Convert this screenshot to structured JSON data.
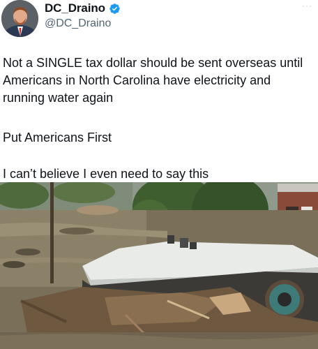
{
  "author": {
    "display_name": "DC_Draino",
    "handle": "@DC_Draino",
    "verified": true,
    "verified_color": "#1d9bf0"
  },
  "menu": {
    "more_icon": "···"
  },
  "tweet": {
    "paragraph_1": "Not a SINGLE tax dollar should be sent overseas until Americans in North Carolina have electricity and running water again",
    "paragraph_2": "Put Americans First",
    "paragraph_3": "I can’t believe I even need to say this"
  },
  "media": {
    "type": "photo"
  }
}
